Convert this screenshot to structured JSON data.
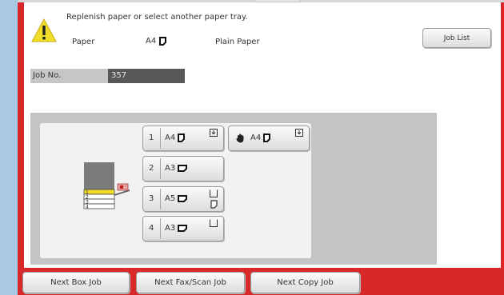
{
  "message": {
    "text": "Replenish paper or select another paper tray.",
    "paper_label": "Paper",
    "paper_size": "A4",
    "paper_type": "Plain Paper"
  },
  "job_list_label": "Job List",
  "job": {
    "label": "Job No.",
    "number": "357"
  },
  "trays": [
    {
      "number": "1",
      "size": "A4",
      "selected": true
    },
    {
      "number": "2",
      "size": "A3"
    },
    {
      "number": "3",
      "size": "A5"
    },
    {
      "number": "4",
      "size": "A3"
    }
  ],
  "bypass": {
    "size": "A4"
  },
  "machine_trays": [
    "1",
    "2",
    "3",
    "4"
  ],
  "bottom_buttons": [
    "Next Box Job",
    "Next Fax/Scan Job",
    "Next Copy Job"
  ],
  "colors": {
    "accent_red": "#d8282a",
    "highlight_yellow": "#f2dc2a",
    "left_strip_blue": "#a9c8e2"
  },
  "icons": {
    "warning": "warning-triangle-icon",
    "portrait": "paper-portrait-icon",
    "landscape": "paper-landscape-icon",
    "hand": "manual-feed-hand-icon"
  }
}
